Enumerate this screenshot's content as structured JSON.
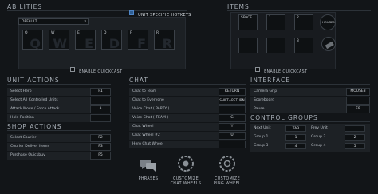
{
  "abilities": {
    "title": "ABILITIES",
    "unit_specific_label": "UNIT SPECIFIC HOTKEYS",
    "profile": "DEFAULT",
    "slots": [
      {
        "key": "Q",
        "bg": "Q"
      },
      {
        "key": "W",
        "bg": "W"
      },
      {
        "key": "E",
        "bg": "E"
      },
      {
        "key": "D",
        "bg": "D"
      },
      {
        "key": "F",
        "bg": "F"
      },
      {
        "key": "R",
        "bg": "R"
      }
    ],
    "quickcast_label": "ENABLE QUICKCAST"
  },
  "items": {
    "title": "ITEMS",
    "keys": [
      "SPACE",
      "1",
      "2",
      "",
      "",
      "3",
      "",
      ""
    ],
    "neutral_label": "HOUSE5",
    "quickcast_label": "ENABLE QUICKCAST"
  },
  "unit_actions": {
    "title": "UNIT ACTIONS",
    "rows": [
      {
        "label": "Select Hero",
        "key": "F1"
      },
      {
        "label": "Select All Controlled Units",
        "key": ""
      },
      {
        "label": "Attack Move / Force Attack",
        "key": "A"
      },
      {
        "label": "Hold Position",
        "key": ""
      }
    ]
  },
  "shop_actions": {
    "title": "SHOP ACTIONS",
    "rows": [
      {
        "label": "Select Courier",
        "key": "F2"
      },
      {
        "label": "Courier Deliver Items",
        "key": "F3"
      },
      {
        "label": "Purchase Quickbuy",
        "key": "F5"
      }
    ]
  },
  "chat": {
    "title": "CHAT",
    "rows": [
      {
        "label": "Chat to Team",
        "key": "RETURN"
      },
      {
        "label": "Chat to Everyone",
        "key": "SHIFT+RETURN"
      },
      {
        "label": "Voice Chat ( PARTY )",
        "key": ""
      },
      {
        "label": "Voice Chat ( TEAM )",
        "key": "G"
      },
      {
        "label": "Chat Wheel",
        "key": "Y"
      },
      {
        "label": "Chat Wheel #2",
        "key": "U"
      },
      {
        "label": "Hero Chat Wheel",
        "key": ""
      }
    ]
  },
  "interface": {
    "title": "INTERFACE",
    "rows": [
      {
        "label": "Camera Grip",
        "key": "MOUSE3"
      },
      {
        "label": "Scoreboard",
        "key": ""
      },
      {
        "label": "Pause",
        "key": "F9"
      }
    ]
  },
  "control_groups": {
    "title": "CONTROL GROUPS",
    "left": [
      {
        "label": "Next Unit",
        "key": "TAB"
      },
      {
        "label": "Group 1",
        "key": "1"
      },
      {
        "label": "Group 3",
        "key": "4"
      }
    ],
    "right": [
      {
        "label": "Prev Unit",
        "key": ""
      },
      {
        "label": "Group 2",
        "key": "2"
      },
      {
        "label": "Group 4",
        "key": "5"
      }
    ]
  },
  "buttons": {
    "phrases": "PHRASES",
    "chat_wheels_1": "CUSTOMIZE",
    "chat_wheels_2": "CHAT WHEELS",
    "ping_wheel_1": "CUSTOMIZE",
    "ping_wheel_2": "PING WHEEL"
  },
  "colors": {
    "background": "#121518",
    "panel": "#1c2024",
    "key_bg": "#0e1113"
  }
}
